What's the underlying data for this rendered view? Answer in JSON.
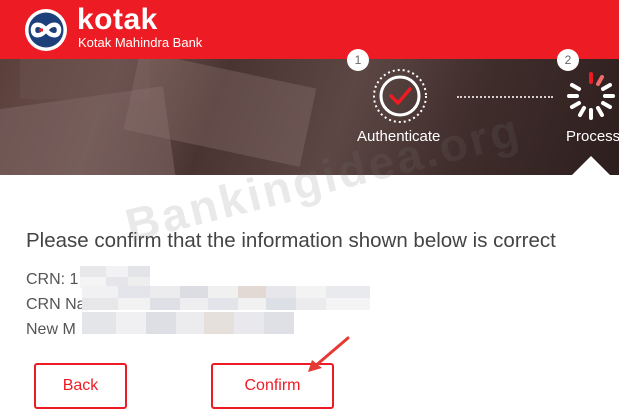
{
  "header": {
    "brand_name": "kotak",
    "brand_sub": "Kotak Mahindra Bank",
    "logo_icon": "kotak-infinity-logo-icon",
    "color": "#ed1c24"
  },
  "steps": [
    {
      "number": "1",
      "label": "Authenticate",
      "status": "done",
      "icon": "check-icon"
    },
    {
      "number": "2",
      "label": "Process",
      "status": "in-progress",
      "icon": "loading-spinner-icon"
    }
  ],
  "main": {
    "heading": "Please confirm that the information shown below is correct",
    "rows": [
      {
        "label": "CRN: 1"
      },
      {
        "label": "CRN Na"
      },
      {
        "label": "New M"
      }
    ]
  },
  "buttons": {
    "back_label": "Back",
    "confirm_label": "Confirm"
  },
  "watermark": "Bankingidea.org",
  "colors": {
    "accent": "#ed1c24",
    "arrow": "#e53935"
  }
}
